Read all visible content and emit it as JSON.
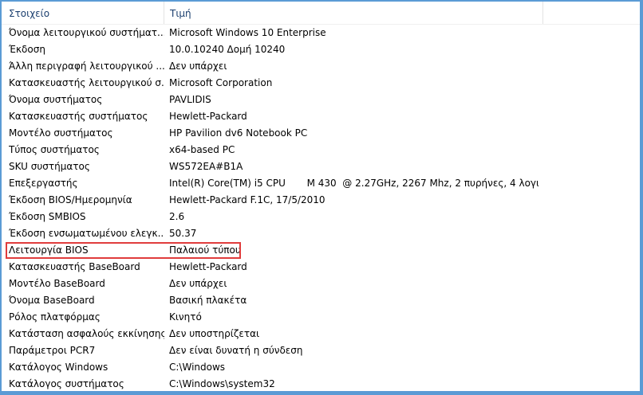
{
  "columns": {
    "item": "Στοιχείο",
    "value": "Τιμή"
  },
  "rows": [
    {
      "item": "Όνομα λειτουργικού συστήματ...",
      "value": "Microsoft Windows 10 Enterprise"
    },
    {
      "item": "Έκδοση",
      "value": "10.0.10240 Δομή 10240"
    },
    {
      "item": "Άλλη περιγραφή λειτουργικού ...",
      "value": "Δεν υπάρχει"
    },
    {
      "item": "Κατασκευαστής λειτουργικού σ...",
      "value": "Microsoft Corporation"
    },
    {
      "item": "Όνομα συστήματος",
      "value": "PAVLIDIS"
    },
    {
      "item": "Κατασκευαστής συστήματος",
      "value": "Hewlett-Packard"
    },
    {
      "item": "Μοντέλο συστήματος",
      "value": "HP Pavilion dv6 Notebook PC"
    },
    {
      "item": "Τύπος συστήματος",
      "value": "x64-based PC"
    },
    {
      "item": "SKU συστήματος",
      "value": "WS572EA#B1A"
    },
    {
      "item": "Επεξεργαστής",
      "value": "Intel(R) Core(TM) i5 CPU       M 430  @ 2.27GHz, 2267 Mhz, 2 πυρήνες, 4 λογι..."
    },
    {
      "item": "Έκδοση BIOS/Ημερομηνία",
      "value": "Hewlett-Packard F.1C, 17/5/2010"
    },
    {
      "item": "Έκδοση SMBIOS",
      "value": "2.6"
    },
    {
      "item": "Έκδοση ενσωματωμένου ελεγκ...",
      "value": "50.37"
    },
    {
      "item": "Λειτουργία BIOS",
      "value": "Παλαιού τύπου"
    },
    {
      "item": "Κατασκευαστής BaseBoard",
      "value": "Hewlett-Packard"
    },
    {
      "item": "Μοντέλο BaseBoard",
      "value": "Δεν υπάρχει"
    },
    {
      "item": "Όνομα BaseBoard",
      "value": "Βασική πλακέτα"
    },
    {
      "item": "Ρόλος πλατφόρμας",
      "value": "Κινητό"
    },
    {
      "item": "Κατάσταση ασφαλούς εκκίνησης",
      "value": "Δεν υποστηρίζεται"
    },
    {
      "item": "Παράμετροι PCR7",
      "value": "Δεν είναι δυνατή η σύνδεση"
    },
    {
      "item": "Κατάλογος Windows",
      "value": "C:\\Windows"
    },
    {
      "item": "Κατάλογος συστήματος",
      "value": "C:\\Windows\\system32"
    }
  ],
  "highlighted_row": "Λειτουργία BIOS",
  "colors": {
    "frame": "#5b9bd5",
    "header_text": "#1a3e6e",
    "highlight": "#e03c3c"
  }
}
